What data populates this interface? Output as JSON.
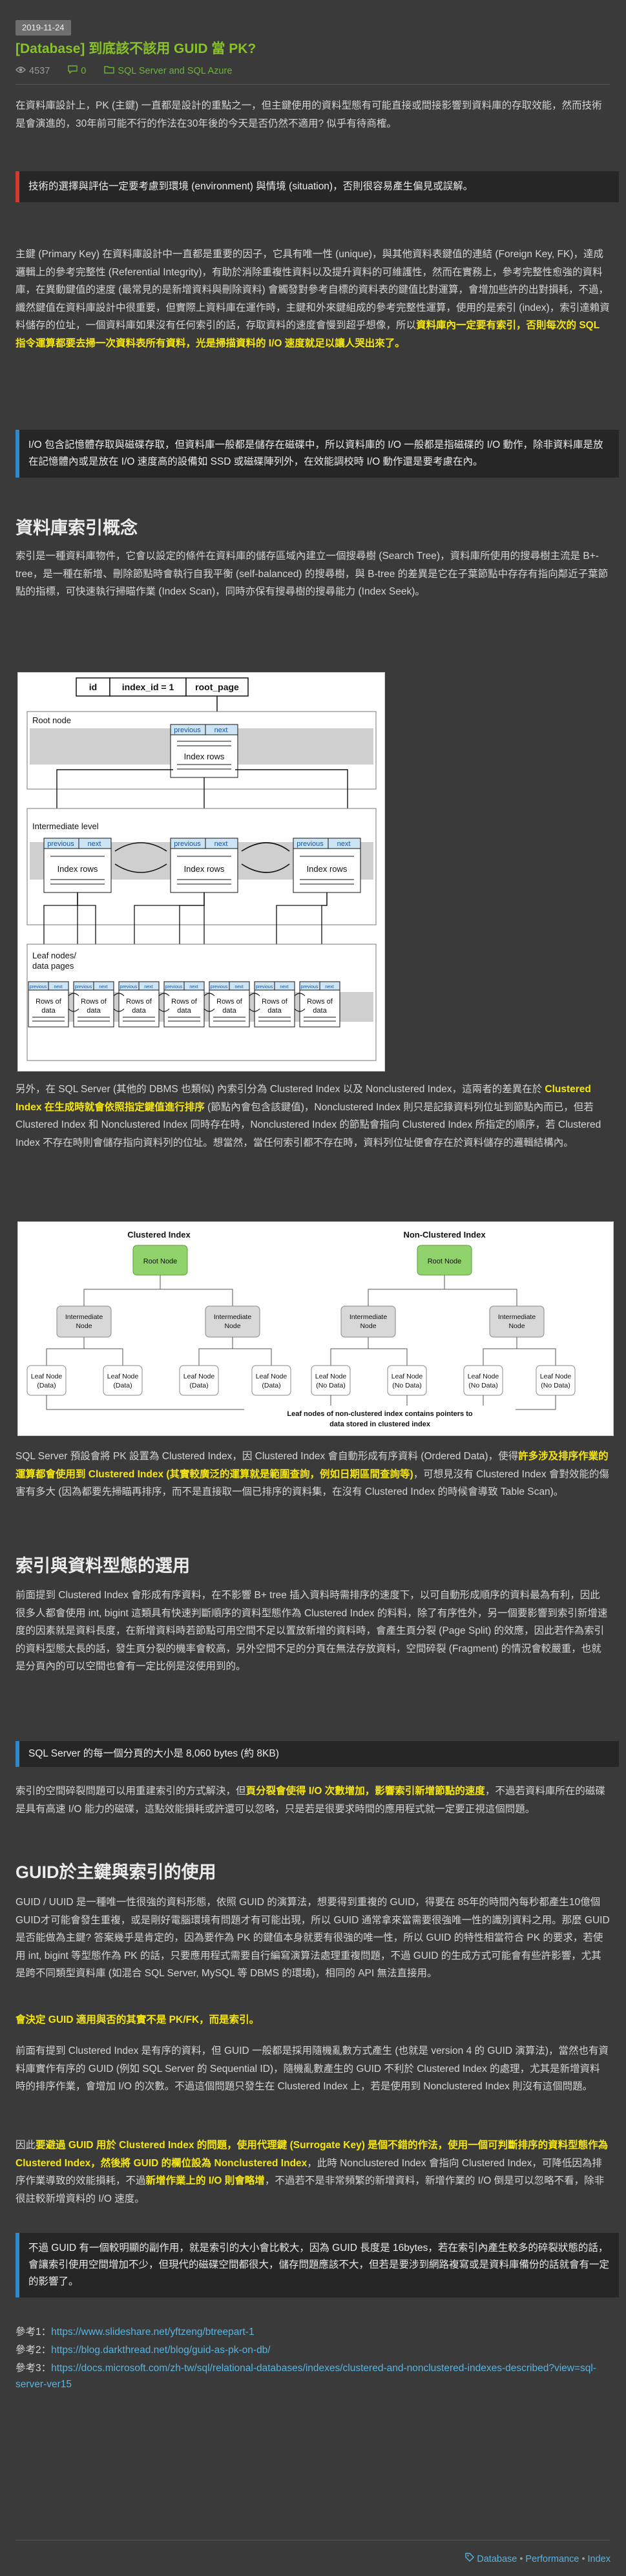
{
  "post": {
    "date": "2019-11-24",
    "title": "[Database] 到底該不該用 GUID 當 PK?",
    "views": "4537",
    "comments": "0",
    "categories": "SQL Server and SQL Azure"
  },
  "intro": "在資料庫設計上，PK (主鍵) 一直都是設計的重點之一，但主鍵使用的資料型態有可能直接或間接影響到資料庫的存取效能，然而技術是會演進的，30年前可能不行的作法在30年後的今天是否仍然不適用? 似乎有待商榷。",
  "note1": "技術的選擇與評估一定要考慮到環境 (environment) 與情境 (situation)，否則很容易產生偏見或誤解。",
  "pk_para": {
    "before": "主鍵 (Primary Key) 在資料庫設計中一直都是重要的因子，它具有唯一性 (unique)，與其他資料表鍵值的連結 (Foreign Key, FK)，達成邏輯上的參考完整性 (Referential Integrity)，有助於消除重複性資料以及提升資料的可維護性，然而在實務上，參考完整性愈強的資料庫，在異動鍵值的速度 (最常見的是新增資料與刪除資料) 會觸發對參考自標的資料表的鍵值比對運算，會增加些許的出對損耗，不過，纖然鍵值在資料庫設計中很重要，但實際上資料庫在運作時，主鍵和外來鍵組成的參考完整性運算，使用的是索引 (index)，索引達賴資料儲存的位址，一個資料庫如果沒有任何索引的話，存取資料的速度會慢到超乎想像，所以",
    "highlight": "資料庫內一定要有索引，否則每次的 SQL 指令運算都要去掃一次資料表所有資料，光是掃描資料的 I/O 速度就足以讓人哭出來了。"
  },
  "note2": "I/O 包含記憶體存取與磁碟存取，但資料庫一般都是儲存在磁碟中，所以資料庫的 I/O 一般都是指磁碟的 I/O 動作，除非資料庫是放在記憶體內或是放在 I/O 速度高的設備如 SSD 或磁碟陣列外，在效能調校時 I/O 動作還是要考慮在內。",
  "h_index": "資料庫索引概念",
  "index_para": "索引是一種資料庫物件，它會以設定的條件在資料庫的儲存區域內建立一個搜尋樹 (Search Tree)，資料庫所使用的搜尋樹主流是 B+-tree，是一種在新增、刪除節點時會執行自我平衡 (self-balanced) 的搜尋樹，與 B-tree 的差異是它在子葉節點中存存有指向鄰近子葉節點的指標，可快速執行掃瞄作業 (Index Scan)，同時亦保有搜尋樹的搜尋能力 (Index Seek)。",
  "fig1": {
    "header_cells": [
      "id",
      "index_id = 1",
      "root_page"
    ],
    "root_label": "Root node",
    "intermediate_label": "Intermediate level",
    "leaf_label": "Leaf nodes/ data pages",
    "prev": "previous",
    "next": "next",
    "index_rows": "Index rows",
    "rows_of_data": "Rows of data"
  },
  "clustered_para": {
    "before": "另外，在 SQL Server (其他的 DBMS 也類似) 內索引分為 Clustered Index 以及 Nonclustered Index，這兩者的差異在於 ",
    "highlight": "Clustered Index 在生成時就會依照指定鍵值進行排序",
    "after": " (節點內會包含該鍵值)，Nonclustered Index 則只是記錄資料列位址到節點內而已，但若 Clustered Index 和 Nonclustered Index 同時存在時，Nonclustered Index 的節點會指向 Clustered Index 所指定的順序，若 Clustered Index 不存在時則會儲存指向資料列的位址。想當然，當任何索引都不存在時，資料列位址便會存在於資料儲存的邏輯結構內。"
  },
  "fig2": {
    "clustered_title": "Clustered Index",
    "nonclustered_title": "Non-Clustered Index",
    "root": "Root Node",
    "intermediate": "Intermediate Node",
    "leaf_data": "Leaf Node (Data)",
    "leaf_nodata": "Leaf Node (No Data)",
    "caption": "Leaf nodes of non-clustered index contains pointers to data stored in clustered index"
  },
  "sqlserver_para": {
    "before": "SQL Server 預設會將 PK 設置為 Clustered Index，因 Clustered Index 會自動形成有序資料 (Ordered Data)，使得",
    "highlight": "許多涉及排序作業的運算都會使用到 Clustered Index (其實較廣泛的運算就是範圍查詢，例如日期區間查詢等)",
    "after": "，可想見沒有 Clustered Index 會對效能的傷害有多大 (因為都要先掃瞄再排序，而不是直接取一個已排序的資料集，在沒有 Clustered Index 的時候會導致 Table Scan)。"
  },
  "h_types": "索引與資料型態的選用",
  "types_para": "前面提到 Clustered Index 會形成有序資料，在不影響 B+ tree 插入資料時需排序的速度下，以可自動形成順序的資料最為有利，因此很多人都會使用 int, bigint 這類具有快速判斷順序的資料型態作為 Clustered Index 的料料，除了有序性外，另一個要影響到索引新增速度的因素就是資料長度，在新增資料時若節點可用空間不足以置放新增的資料時，會產生頁分裂 (Page Split) 的效應，因此若作為索引的資料型態太長的話，發生頁分裂的機率會較高，另外空間不足的分頁在無法存放資料，空間碎裂 (Fragment) 的情況會較嚴重，也就是分頁內的可以空間也會有一定比例是沒使用到的。",
  "note3": "SQL Server 的每一個分頁的大小是 8,060 bytes (約 8KB)",
  "split_para": {
    "before": "索引的空間碎裂問題可以用重建索引的方式解決，但",
    "highlight": "頁分裂會使得 I/O 次數增加，影響索引新增節點的速度",
    "after": "，不過若資料庫所在的磁碟是具有高速 I/O 能力的磁碟，這點效能損耗或許還可以忽略，只是若是很要求時間的應用程式就一定要正視這個問題。"
  },
  "h_guid": "GUID於主鍵與索引的使用",
  "guid_para": "GUID / UUID 是一種唯一性很強的資料形態，依照 GUID 的演算法，想要得到重複的 GUID，得要在 85年的時間內每秒都產生10億個GUID才可能會發生重複，或是剛好電腦環境有問題才有可能出現，所以 GUID 通常拿來當需要很強唯一性的識別資料之用。那麼 GUID 是否能做為主鍵? 答案幾乎是肯定的，因為要作為 PK 的鍵值本身就要有很強的唯一性，所以 GUID 的特性相當符合 PK 的要求，若使用 int, bigint 等型態作為 PK 的話，只要應用程式需要自行編寫演算法處理重複問題，不過 GUID 的生成方式可能會有些許影響，尤其是跨不同類型資料庫 (如混合 SQL Server, MySQL 等 DBMS 的環境)，相同的 API 無法直接用。",
  "guid_highlight": "會決定 GUID 適用與否的其實不是 PK/FK，而是索引。",
  "guid_para2": "前面有提到 Clustered Index 是有序的資料，但 GUID 一般都是採用隨機亂數方式產生 (也就是 version 4 的 GUID 演算法)，當然也有資料庫實作有序的 GUID (例如 SQL Server 的 Sequential ID)，隨機亂數產生的 GUID 不利於 Clustered Index 的處理，尤其是新增資料時的排序作業，會增加 I/O 的次數。不過這個問題只發生在 Clustered Index 上，若是使用到 Nonclustered Index 則沒有這個問題。",
  "final_para": {
    "before": "因此",
    "highlight1": "要避過 GUID 用於 Clustered Index 的問題，使用代理鍵 (Surrogate Key) 是個不錯的作法，使用一個可判斷排序的資料型態作為 Clustered Index，然後將 GUID 的欄位設為 Nonclustered Index",
    "middle": "，此時 Nonclustered Index 會指向 Clustered Index，可降低因為排序作業導致的效能損耗，不過",
    "highlight2": "新增作業上的 I/O 則會略增",
    "after": "，不過若不是非常頻繁的新增資料，新增作業的 I/O 倒是可以忽略不看，除非很註較新增資料的 I/O 速度。"
  },
  "note4": "不過 GUID 有一個較明顯的副作用，就是索引的大小會比較大，因為 GUID 長度是 16bytes，若在索引內產生較多的碎裂狀態的話，會讓索引使用空間增加不少，但現代的磁碟空間都很大，儲存問題應該不大，但若是要涉到網路複寫或是資料庫備份的話就會有一定的影響了。",
  "refs": [
    {
      "label": "參考1：",
      "url": "https://www.slideshare.net/yftzeng/btreepart-1"
    },
    {
      "label": "參考2：",
      "url": "https://blog.darkthread.net/blog/guid-as-pk-on-db/"
    },
    {
      "label": "參考3：",
      "url": "https://docs.microsoft.com/zh-tw/sql/relational-databases/indexes/clustered-and-nonclustered-indexes-described?view=sql-server-ver15"
    }
  ],
  "tags": [
    "Database",
    "Performance",
    "Index"
  ],
  "colors": {
    "title_green": "#88c22a",
    "highlight_yellow": "#f6e60f",
    "link_blue": "#58b4e0",
    "note_red": "#d13b2e",
    "note_blue": "#2f88c8"
  }
}
